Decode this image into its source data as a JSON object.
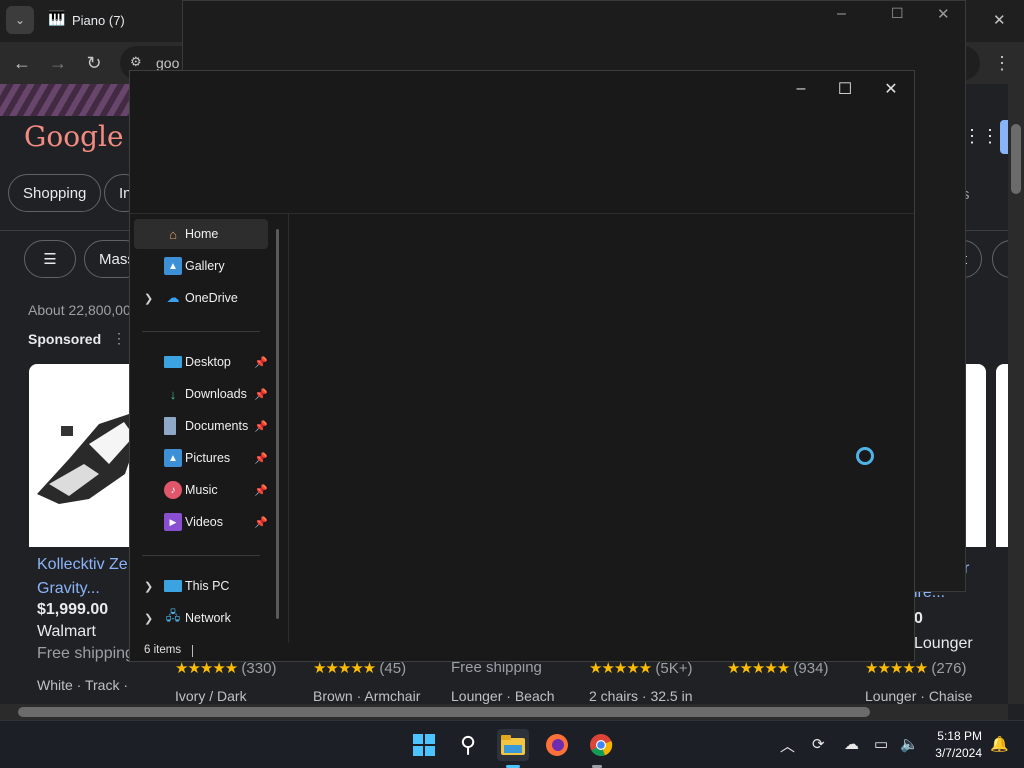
{
  "chrome": {
    "tab_title": "Piano (7)",
    "address_partial": "goo",
    "window_close": "✕"
  },
  "google": {
    "logo_text": "Google",
    "chips": [
      "Shopping",
      "In"
    ],
    "filter_chip": "Mass",
    "right_chip_t": "t",
    "right_chip_s": "s",
    "results_count": "About 22,800,00",
    "sponsored": "Sponsored",
    "cards": [
      {
        "title": "Kollecktiv Ze Gravity...",
        "price": "$1,999.00",
        "store": "Walmart",
        "shipping": "Free shipping",
        "sub": "White · Track ·"
      }
    ],
    "ratings": [
      {
        "stars": "★★★★★",
        "count": "(330)",
        "sub": "Ivory / Dark"
      },
      {
        "stars": "★★★★★",
        "count": "(45)",
        "sub": "Brown · Armchair"
      },
      {
        "stars": "",
        "count": "Free shipping",
        "sub": "Lounger · Beach"
      },
      {
        "stars": "★★★★★",
        "count": "(5K+)",
        "sub": "2 chairs · 32.5 in"
      },
      {
        "stars": "★★★★★",
        "count": "(934)",
        "sub": ""
      },
      {
        "stars": "★★★★★",
        "count": "(276)",
        "sub": "Lounger · Chaise"
      }
    ],
    "right_partial_price": "0",
    "right_partial_store": "Lounger",
    "right_partial_title": "r",
    "right_partial_title2": "ire..."
  },
  "explorer": {
    "nav_top": [
      {
        "label": "Home",
        "icon": "home-icon",
        "selected": true
      },
      {
        "label": "Gallery",
        "icon": "gallery-icon"
      },
      {
        "label": "OneDrive",
        "icon": "onedrive-icon",
        "expand": true
      }
    ],
    "nav_quick": [
      {
        "label": "Desktop",
        "icon": "desktop-icon"
      },
      {
        "label": "Downloads",
        "icon": "downloads-icon"
      },
      {
        "label": "Documents",
        "icon": "documents-icon"
      },
      {
        "label": "Pictures",
        "icon": "pictures-icon"
      },
      {
        "label": "Music",
        "icon": "music-icon"
      },
      {
        "label": "Videos",
        "icon": "videos-icon"
      }
    ],
    "nav_bottom": [
      {
        "label": "This PC",
        "icon": "this-pc-icon"
      },
      {
        "label": "Network",
        "icon": "network-icon"
      }
    ],
    "status": "6 items"
  },
  "taskbar": {
    "time": "5:18 PM",
    "date": "3/7/2024"
  }
}
